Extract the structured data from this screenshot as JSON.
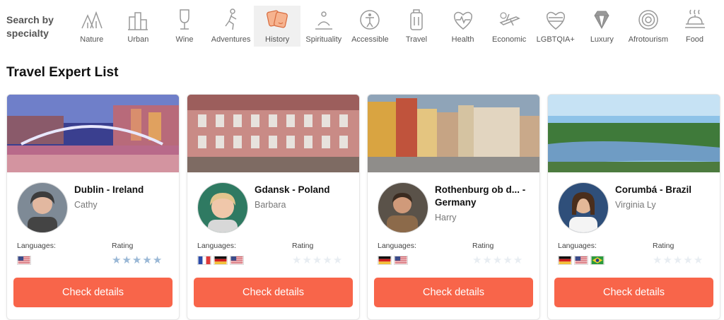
{
  "search_label": "Search by specialty",
  "specialties": [
    {
      "label": "Nature",
      "icon": "nature-icon"
    },
    {
      "label": "Urban",
      "icon": "urban-icon"
    },
    {
      "label": "Wine",
      "icon": "wine-icon"
    },
    {
      "label": "Adventures",
      "icon": "adventures-icon"
    },
    {
      "label": "History",
      "icon": "history-icon",
      "active": true
    },
    {
      "label": "Spirituality",
      "icon": "spirituality-icon"
    },
    {
      "label": "Accessible",
      "icon": "accessible-icon"
    },
    {
      "label": "Travel",
      "icon": "travel-icon"
    },
    {
      "label": "Health",
      "icon": "health-icon"
    },
    {
      "label": "Economic",
      "icon": "economic-icon"
    },
    {
      "label": "LGBTQIA+",
      "icon": "lgbtqia-icon"
    },
    {
      "label": "Luxury",
      "icon": "luxury-icon"
    },
    {
      "label": "Afrotourism",
      "icon": "afrotourism-icon"
    },
    {
      "label": "Food",
      "icon": "food-icon"
    }
  ],
  "section_title": "Travel Expert List",
  "labels": {
    "languages": "Languages:",
    "rating": "Rating"
  },
  "experts": [
    {
      "city": "Dublin - Ireland",
      "name": "Cathy",
      "flags": [
        "us"
      ],
      "rating": 5,
      "button": "Check details"
    },
    {
      "city": "Gdansk - Poland",
      "name": "Barbara",
      "flags": [
        "fr",
        "de",
        "us"
      ],
      "rating": 0,
      "button": "Check details"
    },
    {
      "city": "Rothenburg ob d... - Germany",
      "name": "Harry",
      "flags": [
        "de",
        "us"
      ],
      "rating": 0,
      "button": "Check details"
    },
    {
      "city": "Corumbá - Brazil",
      "name": "Virginia Ly",
      "flags": [
        "de",
        "us",
        "br"
      ],
      "rating": 0,
      "button": "Check details"
    }
  ],
  "colors": {
    "accent": "#f8654a",
    "star_on": "#9ab8d6",
    "star_off": "#e8edf2"
  }
}
